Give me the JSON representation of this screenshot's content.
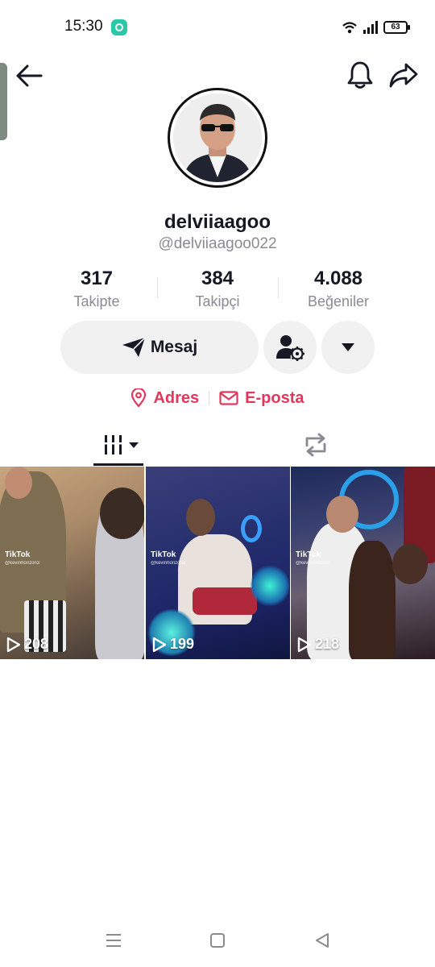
{
  "status_bar": {
    "time": "15:30",
    "battery": "63",
    "icons": [
      "chat-app-icon",
      "wifi-icon",
      "signal-icon",
      "battery-icon"
    ]
  },
  "header": {
    "icons": [
      "back-arrow-icon",
      "bell-icon",
      "share-icon"
    ]
  },
  "profile": {
    "display_name": "delviiaagoo",
    "username": "@delviiaagoo022"
  },
  "stats": [
    {
      "value": "317",
      "label": "Takipte"
    },
    {
      "value": "384",
      "label": "Takipçi"
    },
    {
      "value": "4.088",
      "label": "Beğeniler"
    }
  ],
  "actions": {
    "message_label": "Mesaj",
    "icons": [
      "send-icon",
      "user-settings-icon",
      "caret-down-icon"
    ]
  },
  "links": [
    {
      "label": "Adres",
      "icon": "location-pin-icon"
    },
    {
      "label": "E-posta",
      "icon": "mail-icon"
    }
  ],
  "tabs": [
    {
      "icon": "grid-columns-icon",
      "active": true
    },
    {
      "icon": "repost-icon",
      "active": false
    }
  ],
  "videos": [
    {
      "views": "208",
      "watermark": "TikTok",
      "watermark_handle": "@kevinhorizon3"
    },
    {
      "views": "199",
      "watermark": "TikTok",
      "watermark_handle": "@kevinhorizon3"
    },
    {
      "views": "218",
      "watermark": "TikTok",
      "watermark_handle": "@kevinhorizon3"
    }
  ],
  "colors": {
    "accent": "#e2375d",
    "text": "#161823",
    "muted": "#8a8b91",
    "button_bg": "#f1f1f2"
  }
}
